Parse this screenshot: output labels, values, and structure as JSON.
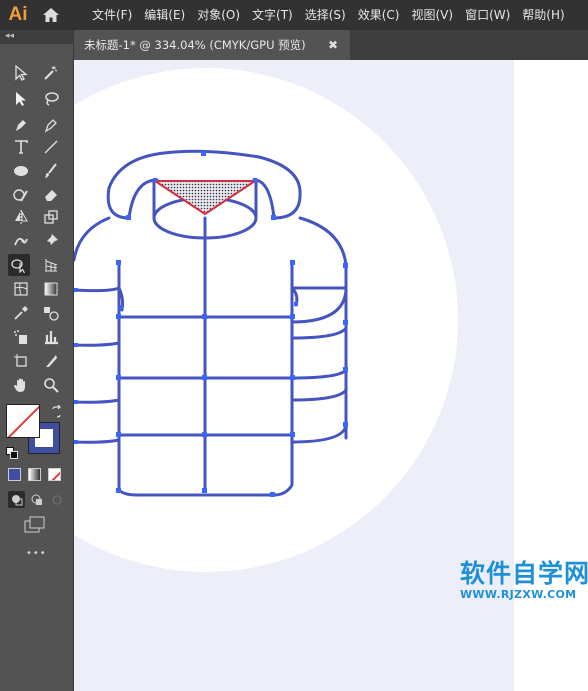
{
  "app": {
    "logo": "Ai"
  },
  "menu": [
    {
      "label": "文件(F)",
      "id": "file"
    },
    {
      "label": "编辑(E)",
      "id": "edit"
    },
    {
      "label": "对象(O)",
      "id": "object"
    },
    {
      "label": "文字(T)",
      "id": "type"
    },
    {
      "label": "选择(S)",
      "id": "select"
    },
    {
      "label": "效果(C)",
      "id": "effect"
    },
    {
      "label": "视图(V)",
      "id": "view"
    },
    {
      "label": "窗口(W)",
      "id": "window"
    },
    {
      "label": "帮助(H)",
      "id": "help"
    }
  ],
  "toolbar": {
    "collapse": "◂◂",
    "more": "•••"
  },
  "document_tab": {
    "title": "未标题-1* @ 334.04% (CMYK/GPU 预览)",
    "close": "✖"
  },
  "colors": {
    "accent": "#f29b38",
    "path_stroke": "#4455c0",
    "anchor": "#3a66ff",
    "selection_red": "#d03040",
    "artboard_bg": "#eceef8",
    "circle_bg": "#ffffff"
  },
  "watermark": {
    "title": "软件自学网",
    "url": "WWW.RJZXW.COM"
  }
}
